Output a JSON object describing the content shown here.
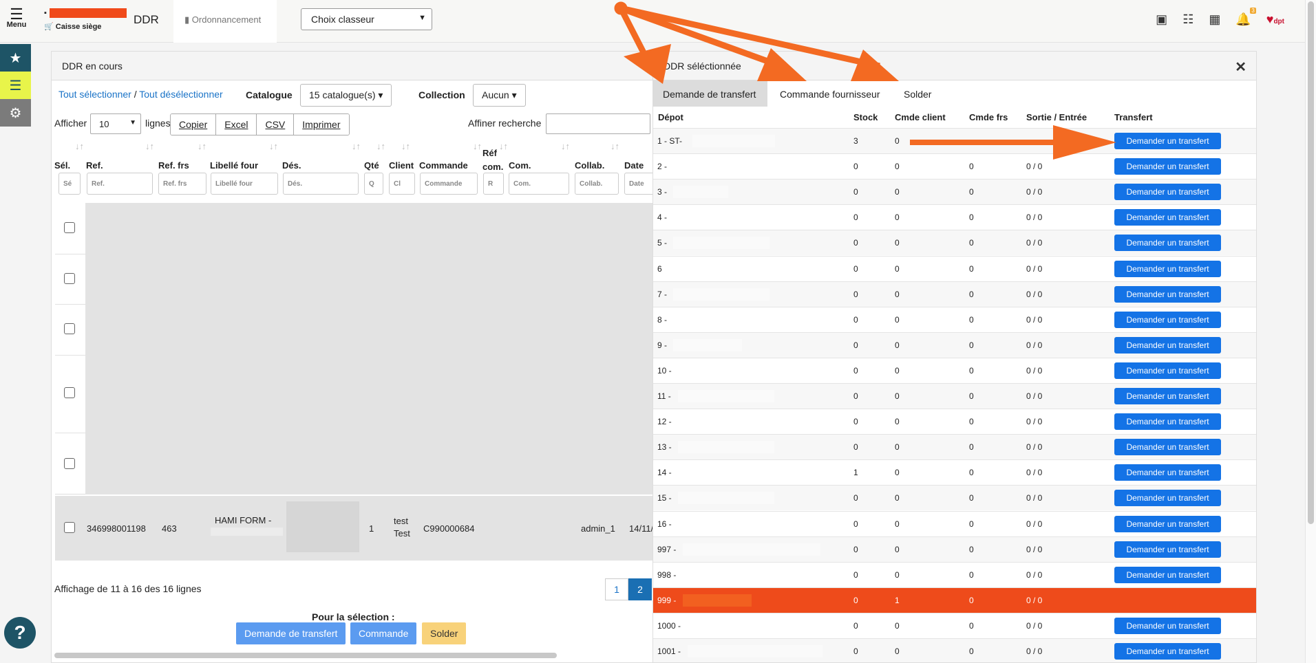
{
  "topbar": {
    "menu_label": "Menu",
    "store_label": "Caisse siège",
    "app_title": "DDR",
    "tab_label": "Ordonnancement",
    "classeur_select": "Choix classeur",
    "notification_count": "3",
    "logo_text": "dpt",
    "icons": [
      "robot-icon",
      "checklist-icon",
      "calendar-icon",
      "bell-icon"
    ]
  },
  "sidebar": {
    "items": [
      {
        "icon": "star-icon",
        "color": "#1e5466"
      },
      {
        "icon": "list-icon",
        "color": "#e8f44a"
      },
      {
        "icon": "gear-icon",
        "color": "#7b7b7b"
      }
    ],
    "help_label": "?"
  },
  "left_panel": {
    "title": "DDR en cours",
    "select_all": "Tout sélectionner",
    "separator": "/",
    "deselect_all": "Tout désélectionner",
    "catalogue_label": "Catalogue",
    "catalogue_value": "15 catalogue(s)",
    "collection_label": "Collection",
    "collection_value": "Aucun",
    "show_label": "Afficher",
    "show_value": "10",
    "rows_label": "lignes",
    "export_buttons": [
      "Copier",
      "Excel",
      "CSV",
      "Imprimer"
    ],
    "search_label": "Affiner recherche",
    "columns": [
      "Sél.",
      "Ref.",
      "Ref. frs",
      "Libellé four",
      "Dés.",
      "Qté",
      "Client",
      "Commande",
      "Réf com.",
      "Com.",
      "Collab.",
      "Date"
    ],
    "filter_placeholders": [
      "Sé",
      "Ref.",
      "Ref. frs",
      "Libellé four",
      "Dés.",
      "Q",
      "Cl",
      "Commande",
      "R",
      "Com.",
      "Collab.",
      "Date"
    ],
    "data_row": {
      "ref": "346998001198",
      "ref_frs": "463",
      "libelle": "HAMI FORM -",
      "qte": "1",
      "client": "test Test",
      "commande": "C990000684",
      "collab": "admin_1",
      "date": "14/11/"
    },
    "info": "Affichage de 11 à 16 des 16 lignes",
    "pages": [
      "1",
      "2"
    ],
    "selection_label": "Pour la sélection :",
    "actions": [
      {
        "label": "Demande de transfert",
        "color": "#5b9bf0"
      },
      {
        "label": "Commande",
        "color": "#5b9bf0"
      },
      {
        "label": "Solder",
        "color": "#f8d27a"
      }
    ]
  },
  "right_panel": {
    "title": "DDR séléctionnée",
    "close": "✕",
    "tabs": [
      "Demande de transfert",
      "Commande fournisseur",
      "Solder"
    ],
    "columns": [
      "Dépot",
      "Stock",
      "Cmde client",
      "Cmde frs",
      "Sortie / Entrée",
      "Transfert"
    ],
    "button_label": "Demander un transfert",
    "rows": [
      {
        "depot": "1 - ST-",
        "stock": "3",
        "cmde_client": "0",
        "cmde_frs": "",
        "sortie": "",
        "button": true
      },
      {
        "depot": "2 -",
        "stock": "0",
        "cmde_client": "0",
        "cmde_frs": "0",
        "sortie": "0 / 0",
        "button": true
      },
      {
        "depot": "3 -",
        "stock": "0",
        "cmde_client": "0",
        "cmde_frs": "0",
        "sortie": "0 / 0",
        "button": true
      },
      {
        "depot": "4 -",
        "stock": "0",
        "cmde_client": "0",
        "cmde_frs": "0",
        "sortie": "0 / 0",
        "button": true
      },
      {
        "depot": "5 -",
        "stock": "0",
        "cmde_client": "0",
        "cmde_frs": "0",
        "sortie": "0 / 0",
        "button": true
      },
      {
        "depot": "6",
        "stock": "0",
        "cmde_client": "0",
        "cmde_frs": "0",
        "sortie": "0 / 0",
        "button": true
      },
      {
        "depot": "7 -",
        "stock": "0",
        "cmde_client": "0",
        "cmde_frs": "0",
        "sortie": "0 / 0",
        "button": true
      },
      {
        "depot": "8 -",
        "stock": "0",
        "cmde_client": "0",
        "cmde_frs": "0",
        "sortie": "0 / 0",
        "button": true
      },
      {
        "depot": "9 -",
        "stock": "0",
        "cmde_client": "0",
        "cmde_frs": "0",
        "sortie": "0 / 0",
        "button": true
      },
      {
        "depot": "10 -",
        "stock": "0",
        "cmde_client": "0",
        "cmde_frs": "0",
        "sortie": "0 / 0",
        "button": true
      },
      {
        "depot": "11 -",
        "stock": "0",
        "cmde_client": "0",
        "cmde_frs": "0",
        "sortie": "0 / 0",
        "button": true
      },
      {
        "depot": "12 -",
        "stock": "0",
        "cmde_client": "0",
        "cmde_frs": "0",
        "sortie": "0 / 0",
        "button": true
      },
      {
        "depot": "13 -",
        "stock": "0",
        "cmde_client": "0",
        "cmde_frs": "0",
        "sortie": "0 / 0",
        "button": true
      },
      {
        "depot": "14 -",
        "stock": "1",
        "cmde_client": "0",
        "cmde_frs": "0",
        "sortie": "0 / 0",
        "button": true
      },
      {
        "depot": "15 -",
        "stock": "0",
        "cmde_client": "0",
        "cmde_frs": "0",
        "sortie": "0 / 0",
        "button": true
      },
      {
        "depot": "16 -",
        "stock": "0",
        "cmde_client": "0",
        "cmde_frs": "0",
        "sortie": "0 / 0",
        "button": true
      },
      {
        "depot": "997 -",
        "stock": "0",
        "cmde_client": "0",
        "cmde_frs": "0",
        "sortie": "0 / 0",
        "button": true
      },
      {
        "depot": "998 -",
        "stock": "0",
        "cmde_client": "0",
        "cmde_frs": "0",
        "sortie": "0 / 0",
        "button": true
      },
      {
        "depot": "999 -",
        "stock": "0",
        "cmde_client": "1",
        "cmde_frs": "0",
        "sortie": "0 / 0",
        "button": false,
        "highlight": true
      },
      {
        "depot": "1000 -",
        "stock": "0",
        "cmde_client": "0",
        "cmde_frs": "0",
        "sortie": "0 / 0",
        "button": true
      },
      {
        "depot": "1001 -",
        "stock": "0",
        "cmde_client": "0",
        "cmde_frs": "0",
        "sortie": "0 / 0",
        "button": true
      }
    ]
  },
  "colors": {
    "accent_blue": "#1473e6",
    "annotation_orange": "#f36a22",
    "highlight_row": "#ee4b1b"
  }
}
